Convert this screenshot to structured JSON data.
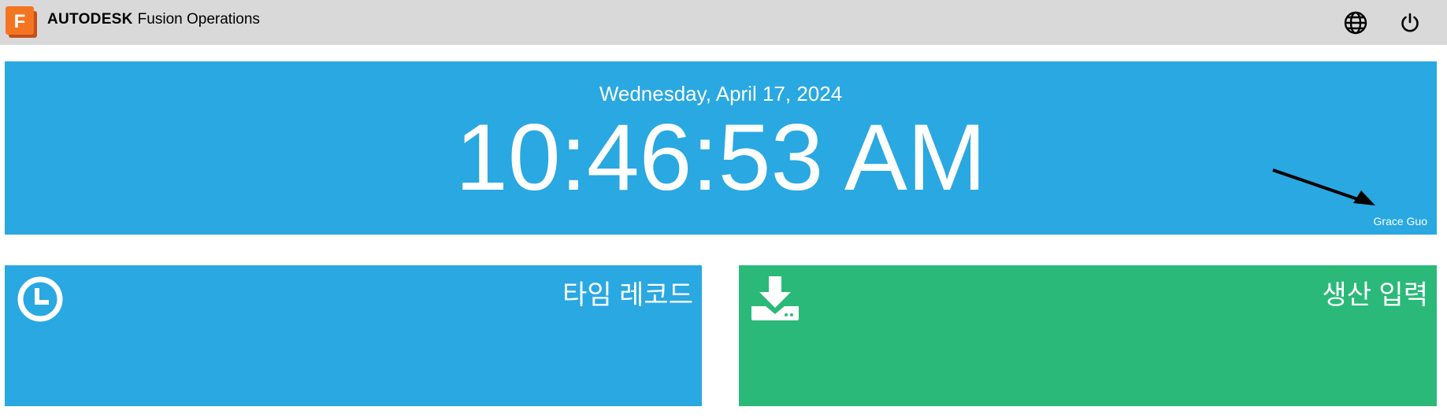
{
  "header": {
    "logo_letter": "F",
    "brand_company": "AUTODESK",
    "brand_product": "Fusion Operations",
    "icons": [
      "globe-icon",
      "power-icon"
    ]
  },
  "clock": {
    "date": "Wednesday, April 17, 2024",
    "time": "10:46:53 AM",
    "user": "Grace Guo"
  },
  "tiles": [
    {
      "title": "타임 레코드",
      "icon": "clock-icon",
      "color": "#29a8e2"
    },
    {
      "title": "생산 입력",
      "icon": "download-tray-icon",
      "color": "#2ab978"
    }
  ],
  "colors": {
    "topbar": "#d9d9d9",
    "accent_blue": "#29a8e2",
    "accent_green": "#2ab978",
    "logo_orange": "#f37521"
  }
}
